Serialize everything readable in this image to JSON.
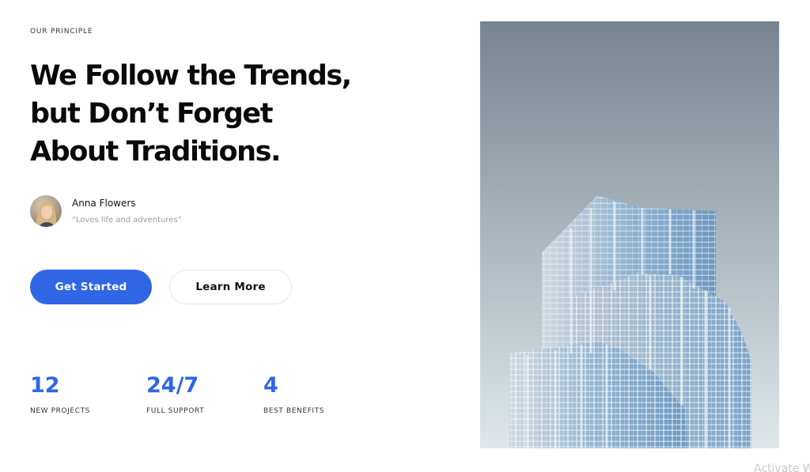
{
  "eyebrow": "OUR PRINCIPLE",
  "headline": {
    "line1": "We Follow the Trends,",
    "line2": "but Don’t Forget",
    "line3": "About Traditions."
  },
  "author": {
    "name": "Anna Flowers",
    "quote": "“Loves life and adventures”"
  },
  "buttons": {
    "primary_label": "Get Started",
    "secondary_label": "Learn More"
  },
  "stats": [
    {
      "value": "12",
      "label": "NEW PROJECTS"
    },
    {
      "value": "24/7",
      "label": "FULL SUPPORT"
    },
    {
      "value": "4",
      "label": "BEST BENEFITS"
    }
  ],
  "watermark": "Activate W",
  "colors": {
    "accent": "#2f66e6",
    "heading": "#0a0a0a",
    "muted": "#9a9a9a"
  }
}
